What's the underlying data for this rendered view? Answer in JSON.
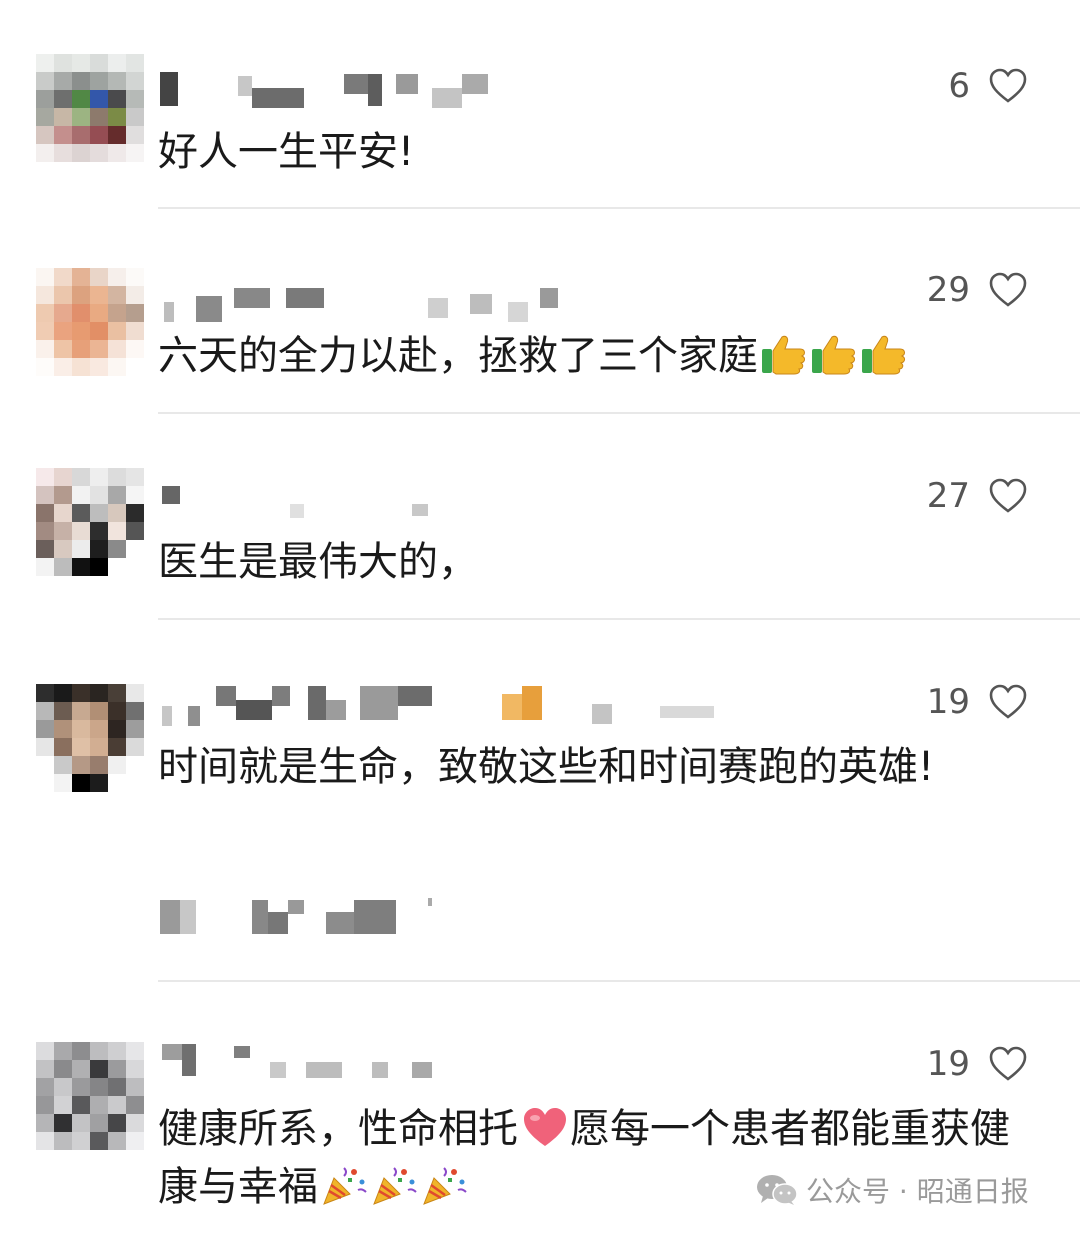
{
  "comments": [
    {
      "like_count": "6",
      "text": "好人一生平安!"
    },
    {
      "like_count": "29",
      "text": "六天的全力以赴，拯救了三个家庭"
    },
    {
      "like_count": "27",
      "text": "医生是最伟大的，"
    },
    {
      "like_count": "19",
      "text": "时间就是生命，致敬这些和时间赛跑的英雄!"
    },
    {
      "like_count": "19",
      "text_1": "健康所系，性命相托",
      "text_2": "愿每一个患者都能重获健康与幸福"
    }
  ],
  "icons": {
    "like": "heart-outline-icon",
    "thumbs_up": "thumbs-up-emoji",
    "heart": "red-heart-emoji",
    "party": "party-popper-emoji",
    "wechat": "wechat-logo-icon"
  },
  "watermark": {
    "text": "公众号 · 昭通日报"
  },
  "colors": {
    "text": "#1a1a1a",
    "count": "#555555",
    "divider": "#e8e8e8",
    "watermark": "#9a9a9a"
  }
}
